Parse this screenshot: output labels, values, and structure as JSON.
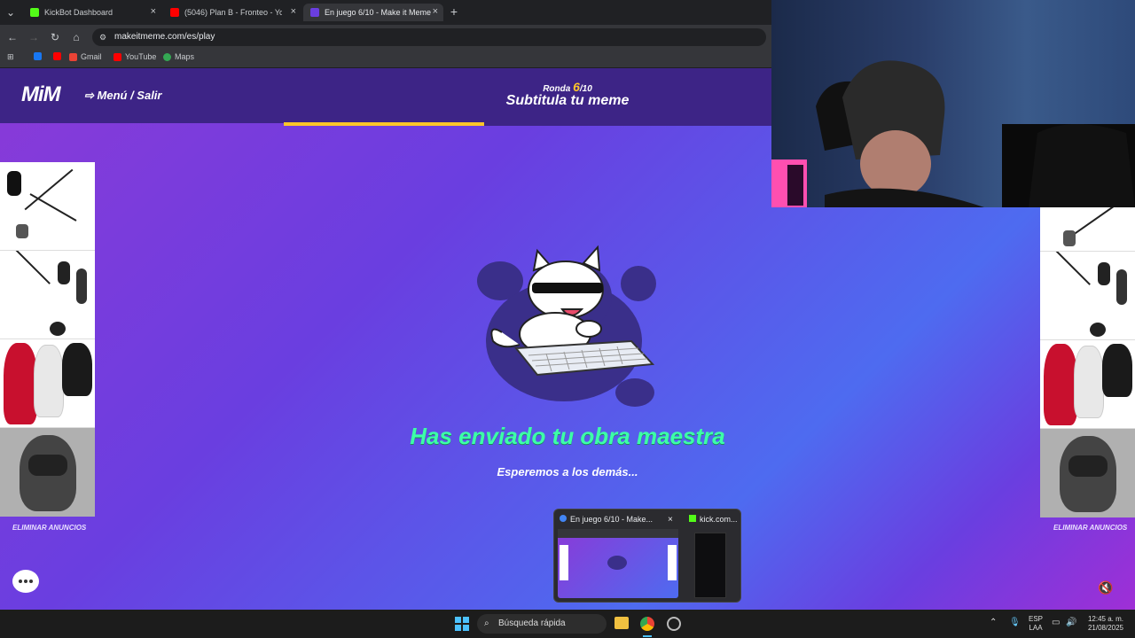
{
  "browser": {
    "tabs": [
      {
        "label": "KickBot Dashboard"
      },
      {
        "label": "(5046) Plan B - Fronteo - Yo"
      },
      {
        "label": "En juego 6/10 - Make it Meme"
      }
    ],
    "url": "makeitmeme.com/es/play",
    "bookmarks": [
      {
        "label": "Gmail"
      },
      {
        "label": "YouTube"
      },
      {
        "label": "Maps"
      }
    ]
  },
  "game": {
    "logo": "MiM",
    "menu_label": "Menú / Salir",
    "round_prefix": "Ronda",
    "round_current": "6",
    "round_total": "/10",
    "title": "Subtitula tu meme",
    "progress": 0.41,
    "status_title": "Has enviado tu obra maestra",
    "status_subtitle": "Esperemos a los demás...",
    "remove_ads_label": "ELIMINAR ANUNCIOS"
  },
  "preview": {
    "window1_title": "En juego 6/10 - Make...",
    "window2_title": "kick.com..."
  },
  "taskbar": {
    "search_label": "Búsqueda rápida",
    "lang": "ESP",
    "lang_sub": "LAA",
    "time": "12:45 a. m.",
    "date": "21/08/2025"
  },
  "colors": {
    "accent": "#ffc629",
    "status_green": "#3dffa8",
    "topbar": "#3d2486"
  }
}
